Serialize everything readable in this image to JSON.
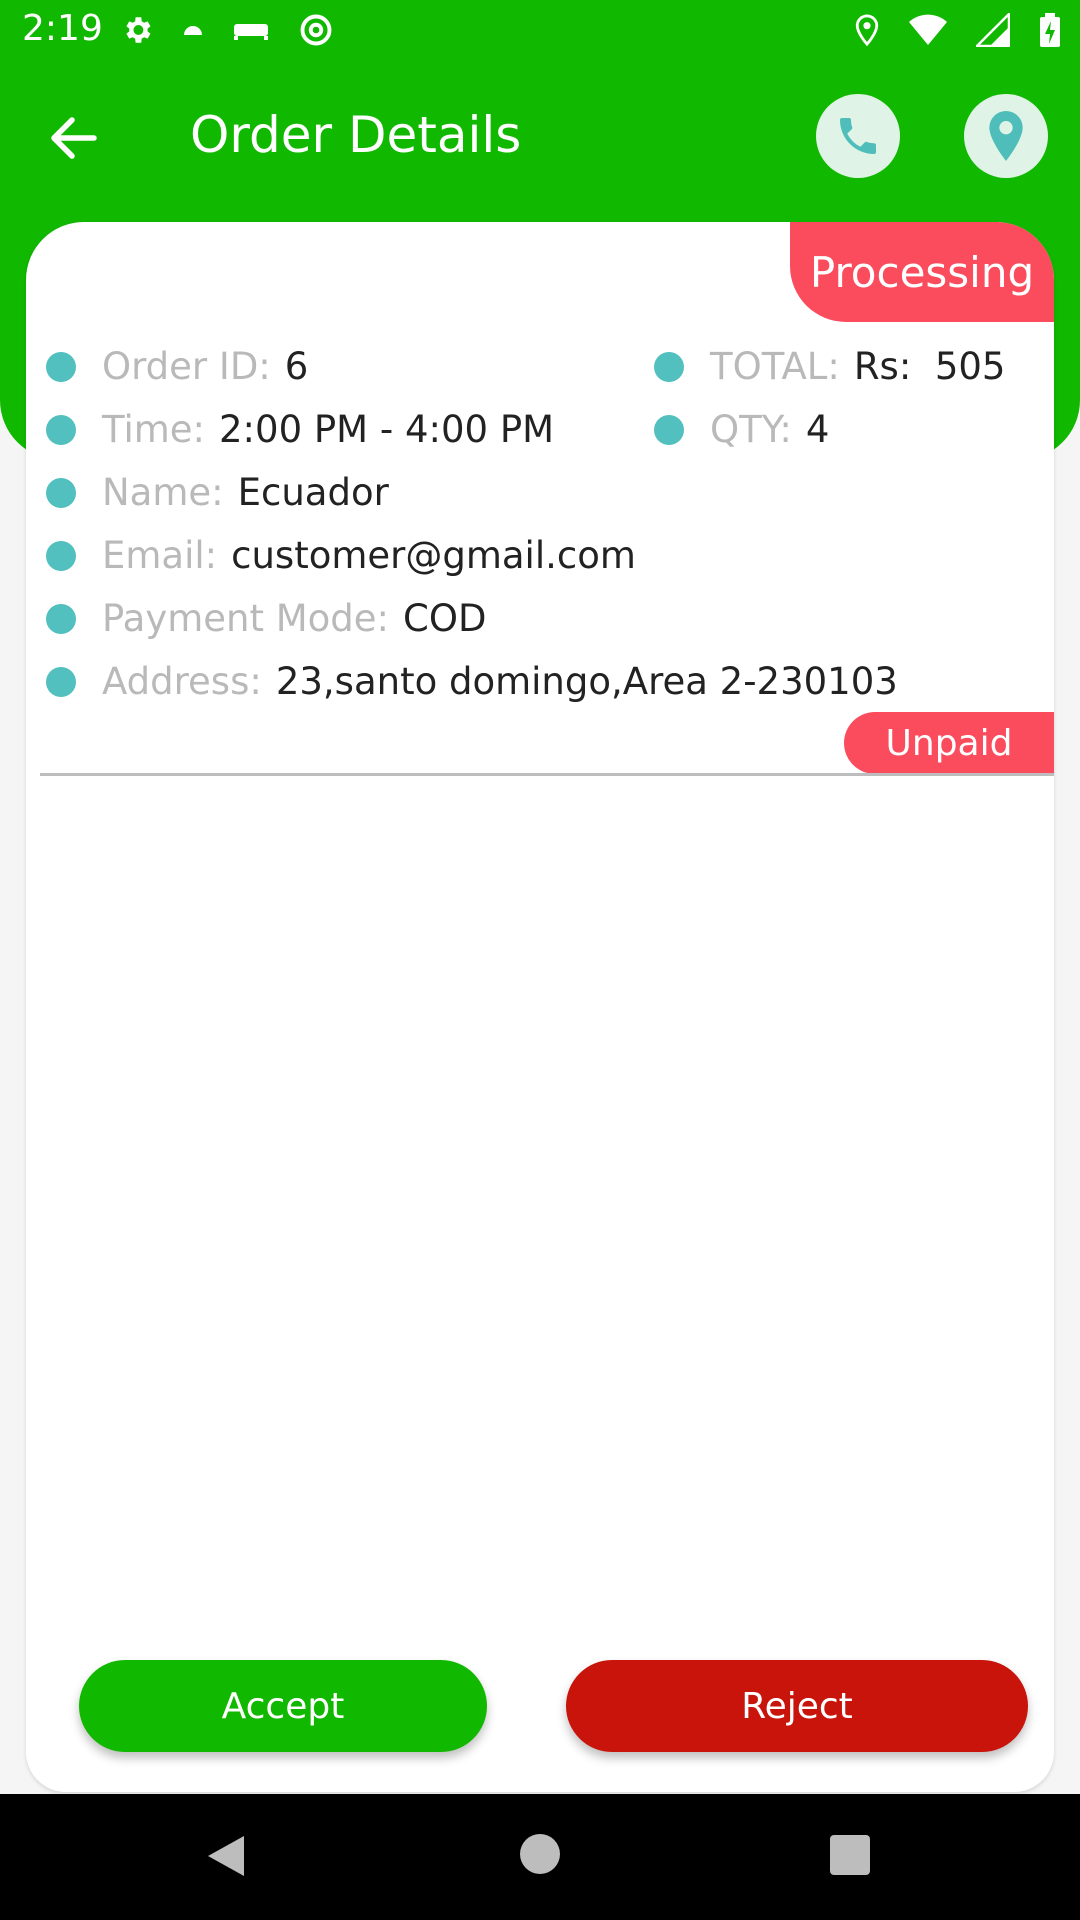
{
  "status_bar": {
    "time": "2:19",
    "left_icons": [
      "gear-icon",
      "android-icon",
      "bed-icon",
      "at-icon"
    ],
    "right_icons": [
      "location-icon",
      "wifi-icon",
      "signal-icon",
      "battery-charging-icon"
    ]
  },
  "appbar": {
    "title": "Order Details",
    "back_icon": "arrow-left-icon",
    "call_icon": "phone-icon",
    "location_icon": "map-pin-icon"
  },
  "order": {
    "status_badge": "Processing",
    "order_id_label": "Order ID:",
    "order_id_value": "6",
    "total_label": "TOTAL:",
    "total_value": "Rs:  505",
    "time_label": "Time:",
    "time_value": "2:00 PM - 4:00 PM",
    "qty_label": "QTY:",
    "qty_value": "4",
    "name_label": "Name:",
    "name_value": "Ecuador",
    "email_label": "Email:",
    "email_value": "customer@gmail.com",
    "payment_label": "Payment Mode:",
    "payment_value": "COD",
    "address_label": "Address:",
    "address_value": "23,santo domingo,Area 2-230103",
    "payment_status_badge": "Unpaid"
  },
  "actions": {
    "accept_label": "Accept",
    "reject_label": "Reject"
  },
  "colors": {
    "primary_green": "#11b800",
    "badge_red": "#fb4c5e",
    "reject_red": "#c8140a",
    "dot_teal": "#52c0be"
  }
}
